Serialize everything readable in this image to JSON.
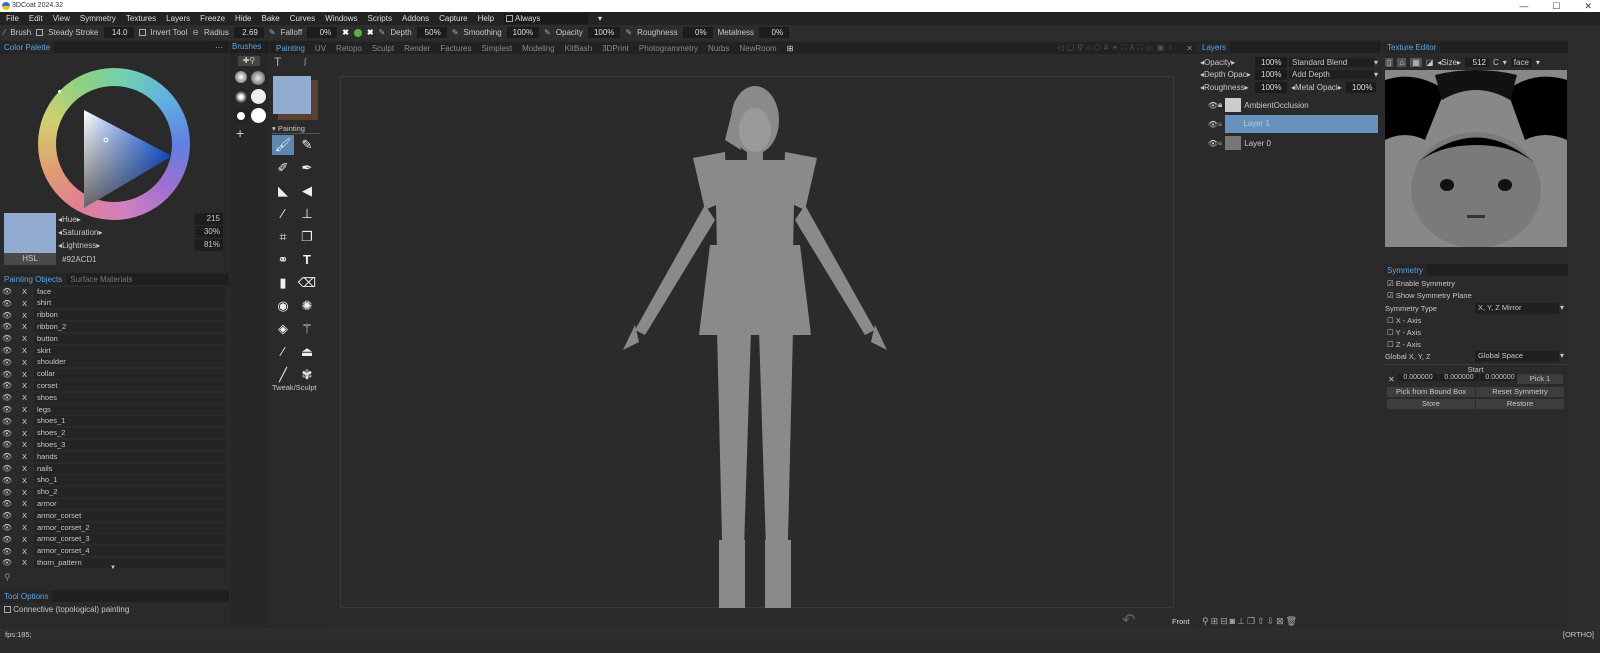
{
  "window": {
    "title": "3DCoat 2024.32",
    "controls": [
      "—",
      "☐",
      "✕"
    ]
  },
  "menu": [
    "File",
    "Edit",
    "View",
    "Symmetry",
    "Textures",
    "Layers",
    "Freeze",
    "Hide",
    "Bake",
    "Curves",
    "Windows",
    "Scripts",
    "Addons",
    "Capture",
    "Help"
  ],
  "always_dropdown": "Always",
  "toolbar": {
    "brush": "Brush",
    "steady_stroke": "Steady Stroke",
    "steady_value": "14.0",
    "invert_tool": "Invert Tool",
    "radius": "Radius",
    "radius_value": "2.69",
    "falloff": "Falloff",
    "falloff_value": "0%",
    "depth": "Depth",
    "depth_value": "50%",
    "smoothing": "Smoothing",
    "smoothing_value": "100%",
    "opacity": "Opacity",
    "opacity_value": "100%",
    "roughness": "Roughness",
    "roughness_value": "0%",
    "metalness": "Metalness",
    "metalness_value": "0%"
  },
  "color_palette": {
    "title": "Color Palette",
    "hue_label": "Hue",
    "hue": "215",
    "sat_label": "Saturation",
    "sat": "30%",
    "light_label": "Lightness",
    "light": "81%",
    "mode": "HSL",
    "hex": "#92ACD1",
    "swatch": "#92ACD1"
  },
  "objects_tabs": [
    "Painting Objects",
    "Surface Materials"
  ],
  "objects": [
    "face",
    "shirt",
    "ribbon",
    "ribbon_2",
    "button",
    "skirt",
    "shoulder",
    "collar",
    "corset",
    "shoes",
    "legs",
    "shoes_1",
    "shoes_2",
    "shoes_3",
    "hands",
    "nails",
    "sho_1",
    "sho_2",
    "armor",
    "armor_corset",
    "armor_corset_2",
    "armor_corset_3",
    "armor_corset_4",
    "thorn_pattern"
  ],
  "tool_options": {
    "title": "Tool Options",
    "connective": "Connective (topological) painting"
  },
  "brushes_title": "Brushes",
  "tools_panel": {
    "section": "Painting",
    "footer": "Tweak/Sculpt"
  },
  "room_tabs": [
    "Painting",
    "UV",
    "Retopo",
    "Sculpt",
    "Render",
    "Factures",
    "Simplest",
    "Modeling",
    "KitBash",
    "3DPrint",
    "Photogrammetry",
    "Nurbs",
    "NewRoom"
  ],
  "viewport": {
    "view_label": "Front"
  },
  "layers": {
    "title": "Layers",
    "opacity_label": "Opacity",
    "opacity": "100%",
    "blend": "Standard Blend",
    "depth_label": "Depth Opac",
    "depth": "100%",
    "depth_mode": "Add Depth",
    "rough_label": "Roughness",
    "rough": "100%",
    "metal_label": "Metal Opaci",
    "metal": "100%",
    "items": [
      "AmbientOcclusion",
      "Layer 1",
      "Layer 0"
    ]
  },
  "texture_editor": {
    "title": "Texture Editor",
    "size_label": "Size",
    "size": "512",
    "channel": "C",
    "object": "face"
  },
  "symmetry": {
    "title": "Symmetry",
    "enable": "Enable Symmetry",
    "show_plane": "Show Symmetry Plane",
    "type_label": "Symmetry Type",
    "type": "X, Y, Z Mirror",
    "x_axis": "X - Axis",
    "y_axis": "Y - Axis",
    "z_axis": "Z - Axis",
    "global_label": "Global X, Y, Z",
    "global": "Global Space",
    "start": "Start",
    "x": "0.000000",
    "y": "0.000000",
    "z": "0.000000",
    "pick": "Pick 1",
    "pick_bbox": "Pick from Bound Box",
    "reset": "Reset Symmetry",
    "store": "Store",
    "restore": "Restore"
  },
  "status": {
    "fps": "fps:185;",
    "mode": "[ORTHO]"
  }
}
